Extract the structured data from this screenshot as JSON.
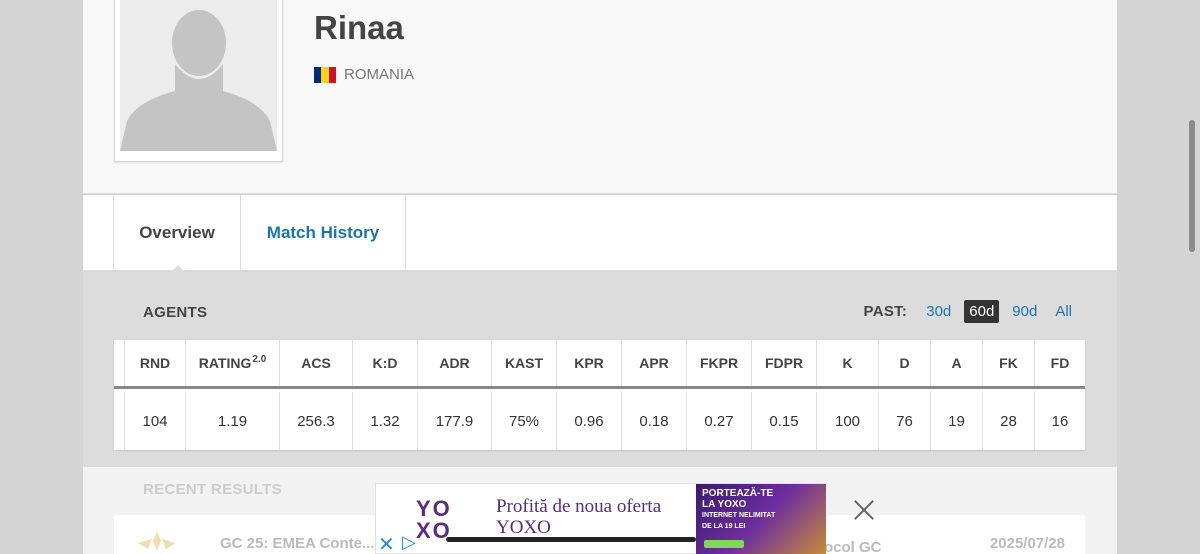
{
  "player": {
    "name": "Rinaa",
    "country": "ROMANIA",
    "flag_colors": [
      "#002B7F",
      "#FCD116",
      "#CE1126"
    ]
  },
  "tabs": [
    {
      "label": "Overview",
      "active": true
    },
    {
      "label": "Match History",
      "active": false
    }
  ],
  "agents": {
    "title": "AGENTS",
    "past_label": "PAST:",
    "past_options": [
      "30d",
      "60d",
      "90d",
      "All"
    ],
    "past_selected": "60d",
    "columns": [
      "RND",
      "RATING",
      "ACS",
      "K:D",
      "ADR",
      "KAST",
      "KPR",
      "APR",
      "FKPR",
      "FDPR",
      "K",
      "D",
      "A",
      "FK",
      "FD"
    ],
    "rating_sup": "2.0",
    "values": [
      "104",
      "1.19",
      "256.3",
      "1.32",
      "177.9",
      "75%",
      "0.96",
      "0.18",
      "0.27",
      "0.15",
      "100",
      "76",
      "19",
      "28",
      "16"
    ]
  },
  "recent": {
    "title": "RECENT RESULTS",
    "event": "GC 25: EMEA Conte...",
    "opponent": "ocol GC",
    "date": "2025/07/28"
  },
  "ad": {
    "brand": "YOXO",
    "logo_line1": "YO",
    "logo_line2": "XO",
    "text_line1": "Profită de noua oferta",
    "text_line2": "YOXO",
    "image_text_1": "PORTEAZĂ-TE",
    "image_text_2": "LA YOXO",
    "image_text_3": "INTERNET NELIMITAT",
    "image_text_4": "DE LA 19 LEI"
  },
  "colors": {
    "link": "#1b75ad",
    "panel": "#dcdcdc",
    "active_pill": "#333333"
  }
}
